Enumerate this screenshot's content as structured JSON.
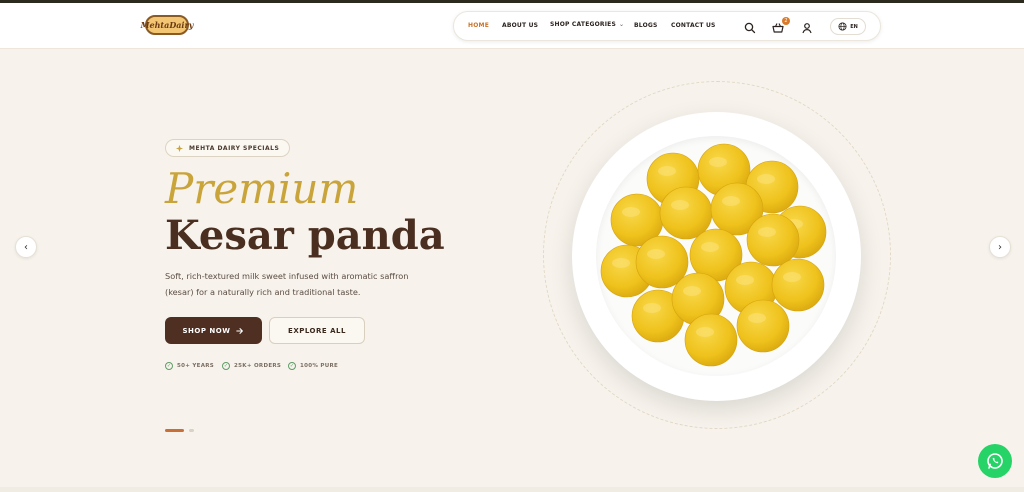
{
  "brand": {
    "logo_text": "MehtaDairy"
  },
  "nav": {
    "items": [
      {
        "label": "HOME",
        "active": true
      },
      {
        "label": "ABOUT US",
        "active": false
      },
      {
        "label": "SHOP CATEGORIES",
        "active": false,
        "has_dropdown": true
      },
      {
        "label": "BLOGS",
        "active": false
      },
      {
        "label": "CONTACT US",
        "active": false
      }
    ],
    "cart_count": "2",
    "language": "EN",
    "icons": [
      "search-icon",
      "basket-icon",
      "user-icon",
      "globe-icon"
    ]
  },
  "hero": {
    "badge": "MEHTA DAIRY SPECIALS",
    "title_italic": "Premium",
    "title_main": "Kesar panda",
    "description": "Soft, rich-textured milk sweet infused with aromatic saffron (kesar) for a naturally rich and traditional taste.",
    "primary_button": "SHOP NOW",
    "secondary_button": "EXPLORE ALL",
    "features": [
      "50+ YEARS",
      "25K+ ORDERS",
      "100% PURE"
    ],
    "slides_total": 2,
    "slide_active": 1
  },
  "colors": {
    "accent": "#c8742a",
    "title_gold": "#c9a43a",
    "title_brown": "#4a2e1f",
    "button_dark": "#4e2f22",
    "background": "#f7f3ec",
    "sweet_yellow": "#f2c21d",
    "whatsapp_green": "#25d366"
  }
}
